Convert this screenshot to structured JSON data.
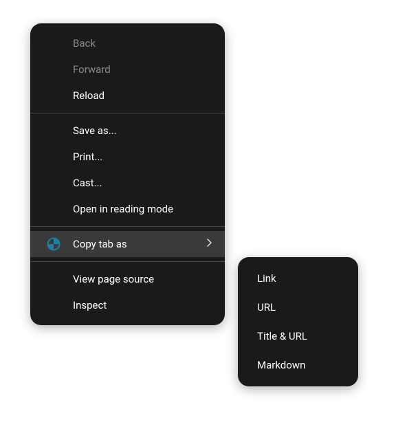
{
  "menu": {
    "back": "Back",
    "forward": "Forward",
    "reload": "Reload",
    "save_as": "Save as...",
    "print": "Print...",
    "cast": "Cast...",
    "open_reading": "Open in reading mode",
    "copy_tab_as": "Copy tab as",
    "view_source": "View page source",
    "inspect": "Inspect"
  },
  "submenu": {
    "link": "Link",
    "url": "URL",
    "title_url": "Title & URL",
    "markdown": "Markdown"
  }
}
